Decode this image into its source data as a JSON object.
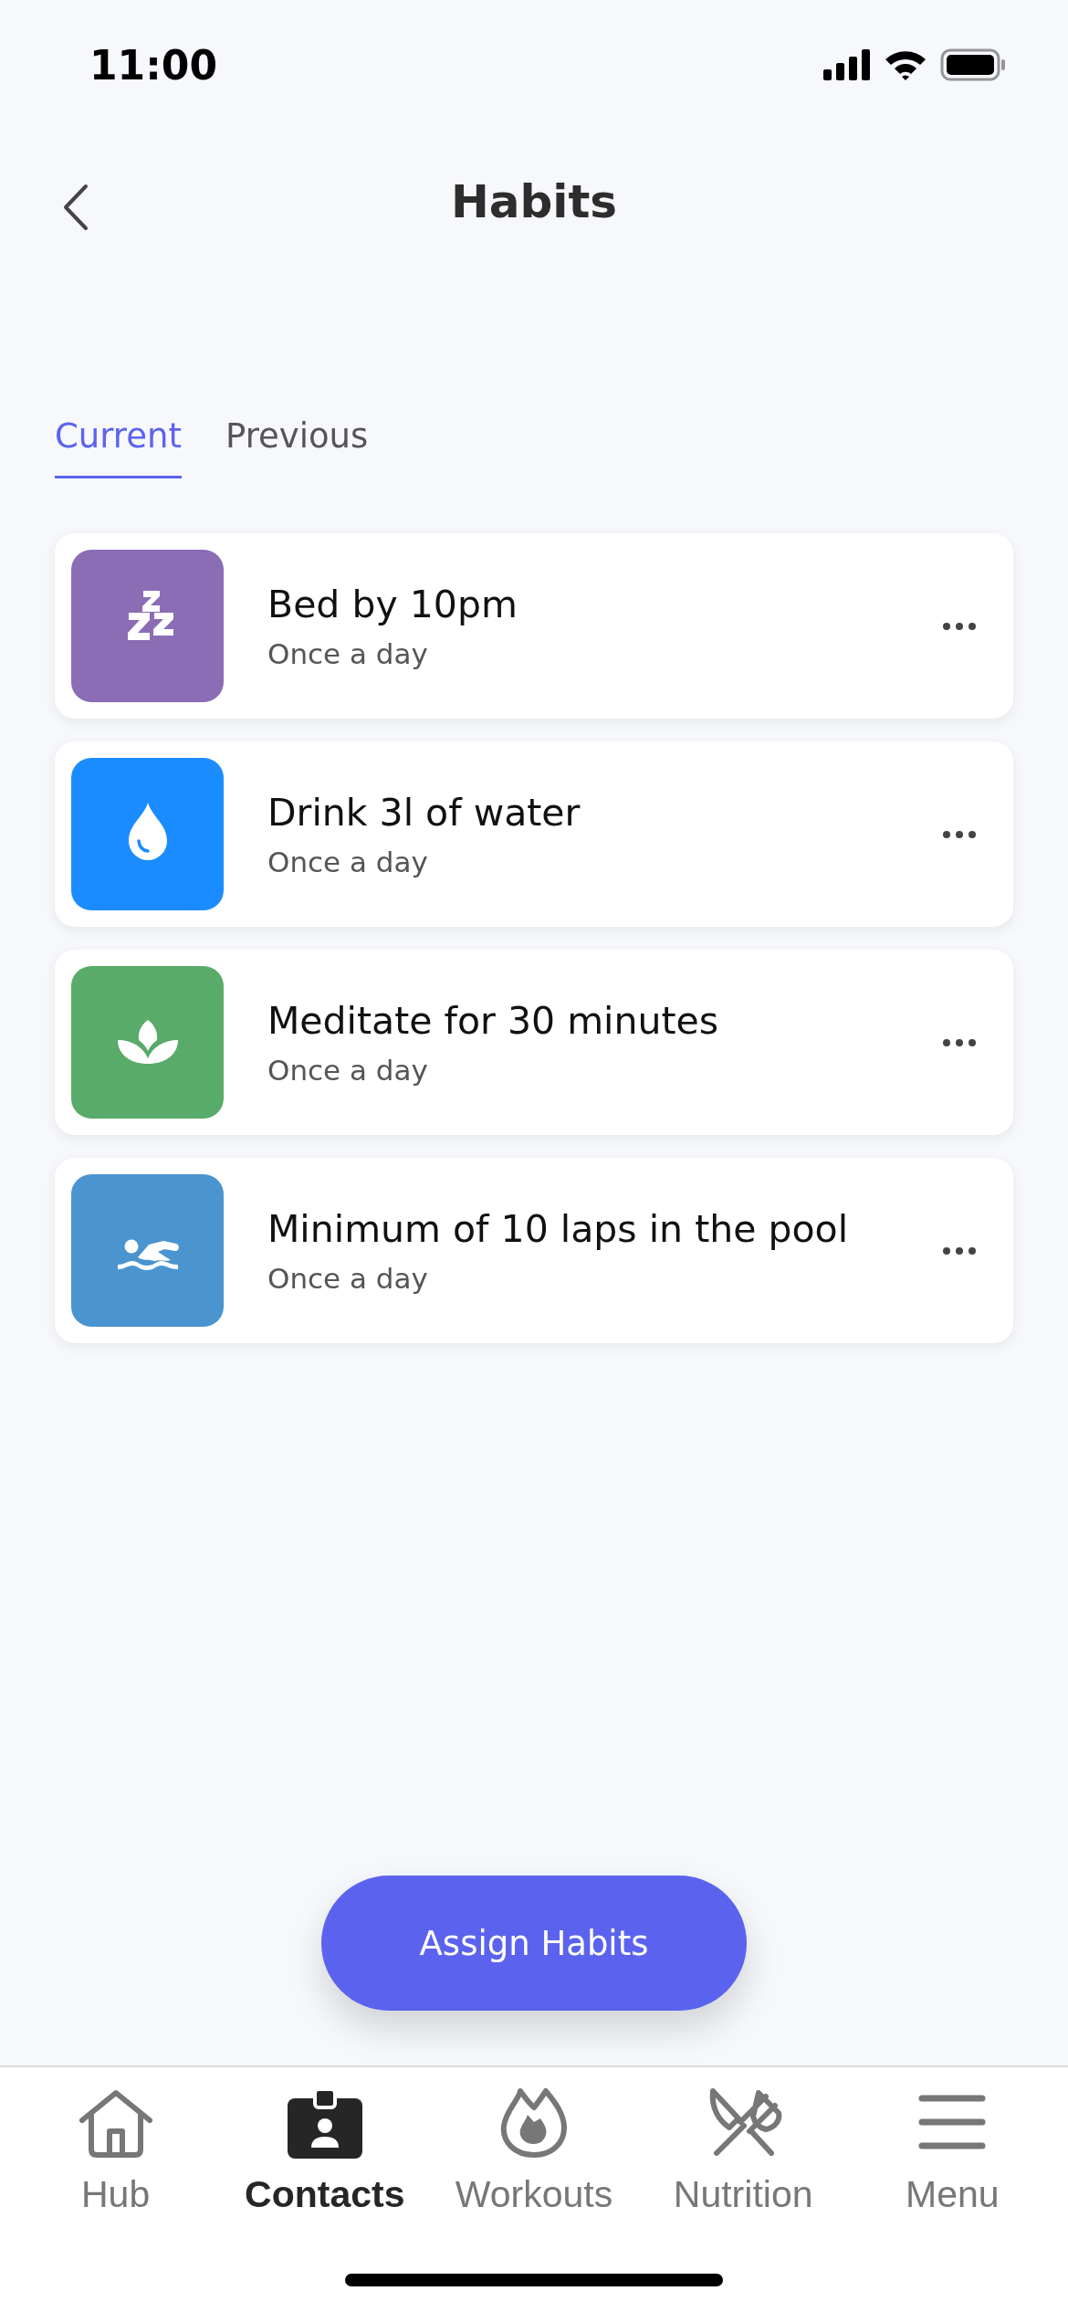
{
  "status_bar": {
    "time": "11:00"
  },
  "header": {
    "title": "Habits"
  },
  "tabs": [
    {
      "label": "Current",
      "selected": true
    },
    {
      "label": "Previous",
      "selected": false
    }
  ],
  "habits": [
    {
      "kind": "sleep",
      "color": "#8a6db5",
      "title": "Bed by 10pm",
      "frequency": "Once a day"
    },
    {
      "kind": "water",
      "color": "#1a8cff",
      "title": "Drink 3l of water",
      "frequency": "Once a day"
    },
    {
      "kind": "meditate",
      "color": "#58ab68",
      "title": "Meditate for 30 minutes",
      "frequency": "Once a day"
    },
    {
      "kind": "swim",
      "color": "#4a94cf",
      "title": "Minimum of 10 laps in the pool",
      "frequency": "Once a day"
    }
  ],
  "assign_button": "Assign Habits",
  "nav": [
    {
      "kind": "hub",
      "label": "Hub",
      "selected": false
    },
    {
      "kind": "contacts",
      "label": "Contacts",
      "selected": true
    },
    {
      "kind": "workouts",
      "label": "Workouts",
      "selected": false
    },
    {
      "kind": "nutrition",
      "label": "Nutrition",
      "selected": false
    },
    {
      "kind": "menu",
      "label": "Menu",
      "selected": false
    }
  ]
}
